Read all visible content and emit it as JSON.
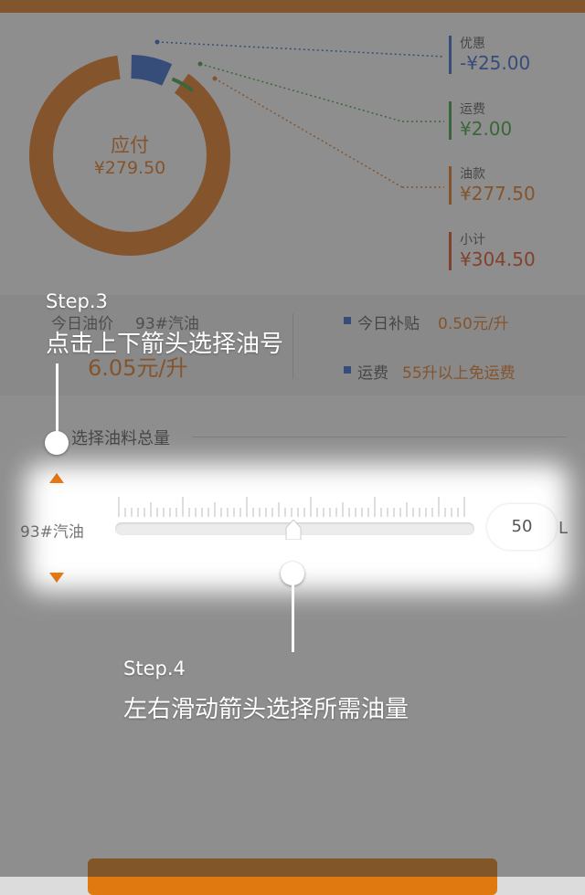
{
  "colors": {
    "accent": "#e8751a",
    "discount": "#2f63ce",
    "shipping": "#3aa13a",
    "fuel": "#e8751a",
    "subtotal": "#e04a1a"
  },
  "summary": {
    "center_title": "应付",
    "center_value": "¥279.50",
    "legend": [
      {
        "label": "优惠",
        "value": "-¥25.00"
      },
      {
        "label": "运费",
        "value": "¥2.00"
      },
      {
        "label": "油款",
        "value": "¥277.50"
      },
      {
        "label": "小计",
        "value": "¥304.50"
      }
    ]
  },
  "price": {
    "today_label": "今日油价",
    "fuel_grade": "93#汽油",
    "price_value": "6.05元/升",
    "subsidy_label": "今日补贴",
    "subsidy_value": "0.50元/升",
    "shipping_label": "运费",
    "shipping_value": "55升以上免运费"
  },
  "selector": {
    "title": "选择油料总量",
    "fuel_type": "93#汽油",
    "amount": "50",
    "unit": "L",
    "slider_fraction": 0.5
  },
  "guide": {
    "step3_title": "Step.3",
    "step3_text": "点击上下箭头选择油号",
    "step4_title": "Step.4",
    "step4_text": "左右滑动箭头选择所需油量"
  },
  "icons": {
    "up": "arrow-up-icon",
    "down": "arrow-down-icon",
    "bullet": "square-bullet-icon"
  }
}
